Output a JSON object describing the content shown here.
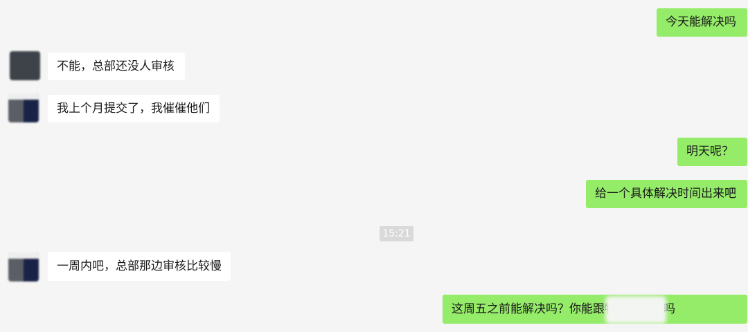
{
  "messages": [
    {
      "side": "out",
      "text": "今天能解决吗"
    },
    {
      "side": "in",
      "text": "不能，总部还没人审核"
    },
    {
      "side": "in",
      "text": "我上个月提交了，我催催他们"
    },
    {
      "side": "out",
      "text": "明天呢？"
    },
    {
      "side": "out",
      "text": "给一个具体解决时间出来吧"
    },
    {
      "side": "in",
      "text": "一周内吧，总部那边审核比较慢"
    },
    {
      "side": "out",
      "text": "这周五之前能解决吗？你能跟物业沟通下吗"
    }
  ],
  "timestamp": "15:21",
  "colors": {
    "background": "#f5f5f5",
    "incoming_bubble": "#ffffff",
    "outgoing_bubble": "#95ec69",
    "timestamp_bg": "#d9d9d9"
  }
}
